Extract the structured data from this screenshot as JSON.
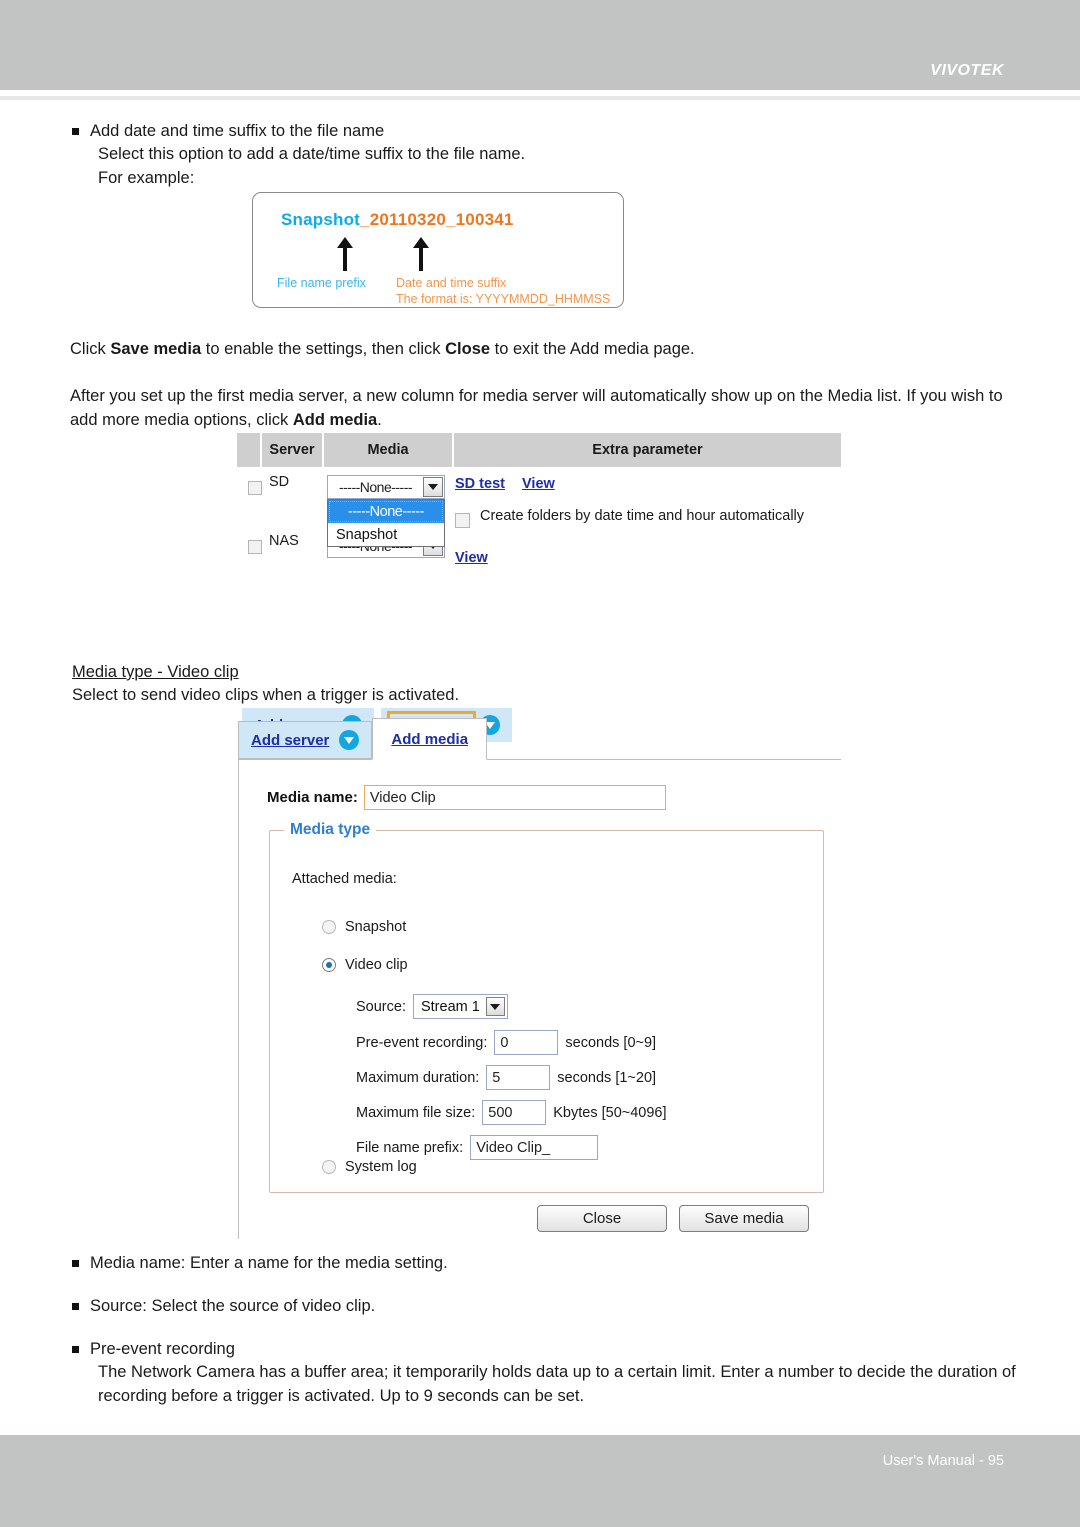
{
  "header": {
    "brand": "VIVOTEK"
  },
  "footer": {
    "text": "User's Manual - 95"
  },
  "section_suffix": {
    "heading": "Add date and time suffix to the file name",
    "line1": "Select this option to add a date/time suffix to the file name.",
    "line2": "For example:"
  },
  "snapshot_example": {
    "prefix": "Snapshot",
    "suffix": "_20110320_100341",
    "label_prefix": "File name prefix",
    "label_suffix": "Date and time suffix",
    "label_format": "The format is: YYYYMMDD_HHMMSS"
  },
  "paragraphs": {
    "p1_a": "Click ",
    "p1_b": "Save media",
    "p1_c": " to enable the settings, then click ",
    "p1_d": "Close",
    "p1_e": " to exit the Add media page.",
    "p2_a": "After you set up the first media server, a new column for media server will automatically show up on the Media list. If you wish to add more media options, click ",
    "p2_b": "Add media",
    "p2_c": "."
  },
  "media_list": {
    "columns": [
      "",
      "Server",
      "Media",
      "Extra parameter"
    ],
    "rows": [
      {
        "server": "SD",
        "media_value": "-----None-----"
      },
      {
        "server": "NAS",
        "media_value": "-----None-----"
      }
    ],
    "dropdown_options": [
      "-----None-----",
      "Snapshot"
    ],
    "dropdown_selected": "-----None-----",
    "sd_test_link": "SD test",
    "view_link_1": "View",
    "view_link_2": "View",
    "create_folders_label": "Create folders by date time and hour automatically"
  },
  "buttons": {
    "add_server": "Add server",
    "add_media": "Add media"
  },
  "section_videoclip": {
    "heading": "Media type - Video clip",
    "line1": "Select to send video clips when a trigger is activated."
  },
  "tabs": {
    "add_server": "Add server",
    "add_media": "Add media"
  },
  "form": {
    "media_name_label": "Media name:",
    "media_name_value": "Video Clip",
    "media_type_legend": "Media type",
    "attached_media_label": "Attached media:",
    "radio_snapshot": "Snapshot",
    "radio_videoclip": "Video clip",
    "radio_systemlog": "System log",
    "source_label": "Source:",
    "source_value": "Stream 1",
    "pre_event_label": "Pre-event recording:",
    "pre_event_value": "0",
    "pre_event_unit": "seconds [0~9]",
    "max_duration_label": "Maximum duration:",
    "max_duration_value": "5",
    "max_duration_unit": "seconds [1~20]",
    "max_filesize_label": "Maximum file size:",
    "max_filesize_value": "500",
    "max_filesize_unit": "Kbytes [50~4096]",
    "file_prefix_label": "File name prefix:",
    "file_prefix_value": "Video Clip_",
    "close_button": "Close",
    "save_button": "Save media"
  },
  "bottom_notes": {
    "n1": "Media name: Enter a name for the media setting.",
    "n2": "Source: Select the source of video clip.",
    "n3_head": "Pre-event recording",
    "n3_body": "The Network Camera has a buffer area; it temporarily holds data up to a certain limit. Enter a number to decide the duration of recording before a trigger is activated. Up to 9 seconds can be set."
  }
}
